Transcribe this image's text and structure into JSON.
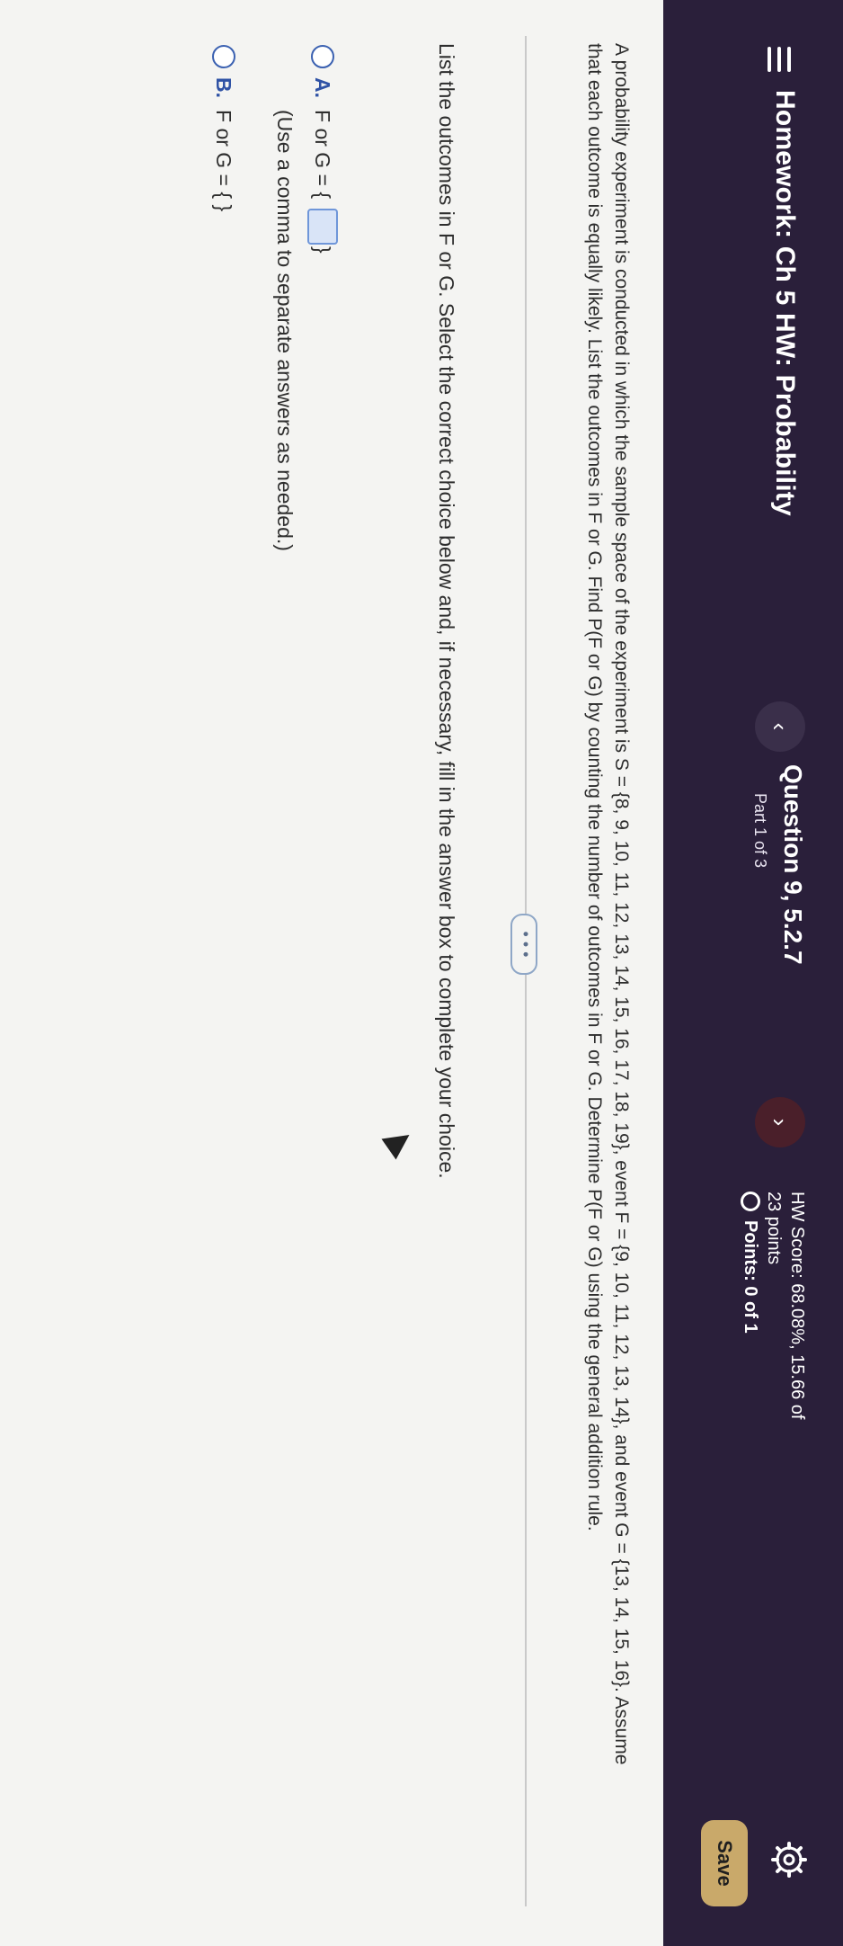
{
  "header": {
    "title": "Homework: Ch 5 HW: Probability",
    "question": "Question 9, 5.2.7",
    "part": "Part 1 of 3",
    "prev_label": "‹",
    "next_label": "›",
    "hw_score": "HW Score: 68.08%, 15.66 of",
    "hw_points": "23 points",
    "points": "Points: 0 of 1",
    "save_label": "Save"
  },
  "problem": {
    "text": "A probability experiment is conducted in which the sample space of the experiment is S = {8, 9, 10, 11, 12, 13, 14, 15, 16, 17, 18, 19}, event F = {9, 10, 11, 12, 13, 14}, and event G = {13, 14, 15, 16}. Assume that each outcome is equally likely. List the outcomes in F or G. Find P(F or G) by counting the number of outcomes in F or G. Determine P(F or G) using the general addition rule.",
    "more_label": "• • •"
  },
  "instruction": "List the outcomes in F or G. Select the correct choice below and, if necessary, fill in the answer box to complete your choice.",
  "choices": [
    {
      "letter": "A.",
      "prefix": "F or G = {",
      "suffix": "}",
      "note": "(Use a comma to separate answers as needed.)"
    },
    {
      "letter": "B.",
      "text": "F or G = { }"
    }
  ],
  "colors": {
    "header_bg": "#2a1f3a",
    "save_bg": "#c9a96a",
    "accent": "#2f52a5"
  }
}
